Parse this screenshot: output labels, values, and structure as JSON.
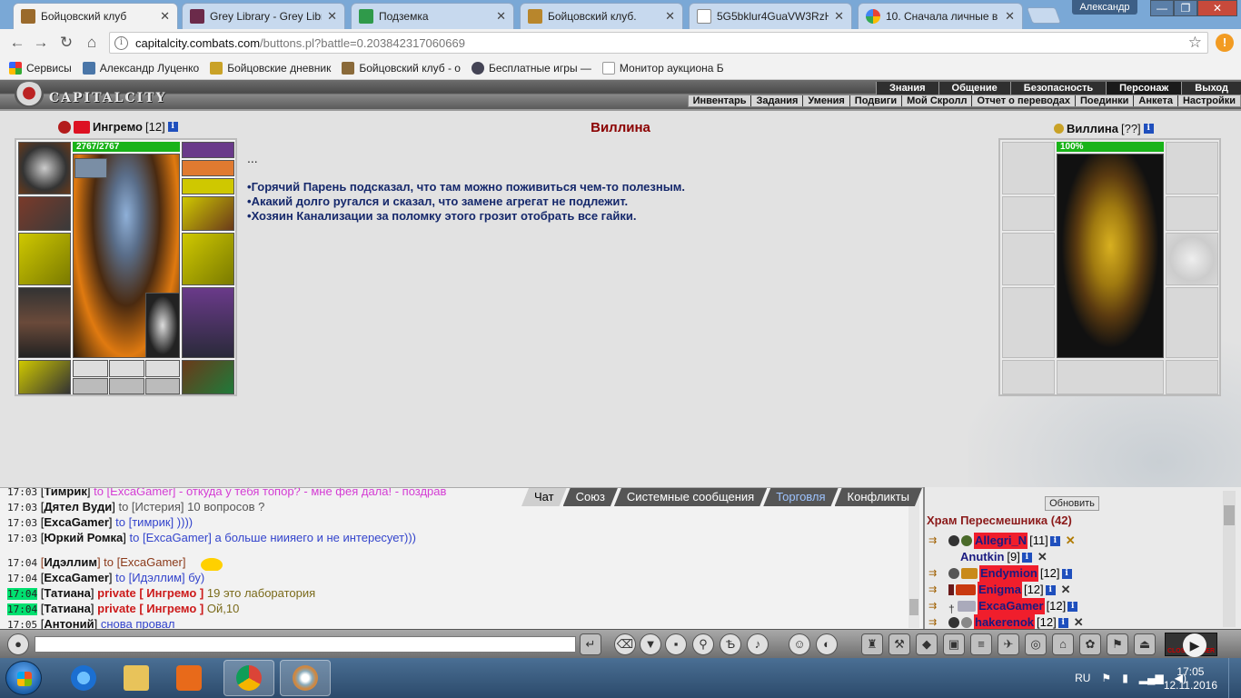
{
  "browser": {
    "tabs": [
      {
        "title": "Бойцовский клуб",
        "active": true
      },
      {
        "title": "Grey Library - Grey Libr"
      },
      {
        "title": "Подземка"
      },
      {
        "title": "Бойцовский клуб."
      },
      {
        "title": "5G5bklur4GuaVW3RzH"
      },
      {
        "title": "10. Сначала личные в"
      }
    ],
    "profile_name": "Александр",
    "url_host": "capitalcity.combats.com",
    "url_path": "/buttons.pl?battle=0.203842317060669",
    "bookmarks": [
      "Сервисы",
      "Александр Луценко",
      "Бойцовские дневник",
      "Бойцовский клуб - о",
      "Бесплатные игры — ",
      "Монитор аукциона Б"
    ]
  },
  "game": {
    "logo_text": "CAPITALCITY",
    "top_menu": [
      "Знания",
      "Общение",
      "Безопасность",
      "Персонаж",
      "Выход"
    ],
    "sub_menu": [
      "Инвентарь",
      "Задания",
      "Умения",
      "Подвиги",
      "Мой Скролл",
      "Отчет о переводах",
      "Поединки",
      "Анкета",
      "Настройки"
    ],
    "player": {
      "name": "Ингремо",
      "level": "[12]",
      "hp": "2767/2767"
    },
    "npc": {
      "name": "Виллина",
      "level": "[??]",
      "hp": "100%"
    },
    "dialog_title": "Виллина",
    "dialog_dots": "...",
    "dialog_lines": [
      "Горячий Парень подсказал, что там можно поживиться чем-то полезным.",
      "Акакий долго ругался и сказал, что замене агрегат не подлежит.",
      "Хозяин Канализации за поломку этого грозит отобрать все гайки."
    ]
  },
  "chat": {
    "tabs": [
      "Чат",
      "Союз",
      "Системные сообщения",
      "Торговля",
      "Конфликты"
    ],
    "lines": [
      {
        "time": "17:03",
        "nick": "Тимрик",
        "to": "to [ExcaGamer]",
        "msg": "- откуда у тебя топор? - мне фея дала! - поздрав",
        "style": "pink"
      },
      {
        "time": "17:03",
        "nick": "Дятел Вуди",
        "to": "to [Истерия]",
        "msg": "10 вопросов ?",
        "style": "gray"
      },
      {
        "time": "17:03",
        "nick": "ExcaGamer",
        "to": "to [тимрик]",
        "msg": "))))",
        "style": ""
      },
      {
        "time": "17:03",
        "nick": "Юркий Ромка",
        "to": "to [ExcaGamer]",
        "msg": "а больше ниияего и не интересует)))",
        "style": ""
      },
      {
        "time": "17:04",
        "nick": "Идэллим",
        "to": "to [ExcaGamer]",
        "msg": "",
        "style": "gap"
      },
      {
        "time": "17:04",
        "nick": "ExcaGamer",
        "to": "to [Идэллим]",
        "msg": "бу)",
        "style": ""
      },
      {
        "time": "17:04",
        "nick": "Татиана",
        "private": "private [ Ингремо ]",
        "msg": "19 это лаборатория",
        "style": "priv"
      },
      {
        "time": "17:04",
        "nick": "Татиана",
        "private": "private [ Ингремо ]",
        "msg": "Ой,10",
        "style": "priv"
      },
      {
        "time": "17:05",
        "nick": "Антоний",
        "to": "",
        "msg": "снова провал",
        "style": ""
      }
    ]
  },
  "room": {
    "refresh_label": "Обновить",
    "title": "Храм Пересмешника (42)",
    "players": [
      {
        "name": "Allegri_N",
        "level": "[11]"
      },
      {
        "name": "Anutkin",
        "level": "[9]"
      },
      {
        "name": "Endymion",
        "level": "[12]"
      },
      {
        "name": "Enigma",
        "level": "[12]"
      },
      {
        "name": "ExcaGamer",
        "level": "[12]"
      },
      {
        "name": "hakerenok",
        "level": "[12]"
      }
    ]
  },
  "toolbar": {
    "chat_input_value": "",
    "logo_text": "CLOSE GAMER"
  },
  "taskbar": {
    "lang": "RU",
    "time": "17:05",
    "date": "12.11.2016"
  }
}
